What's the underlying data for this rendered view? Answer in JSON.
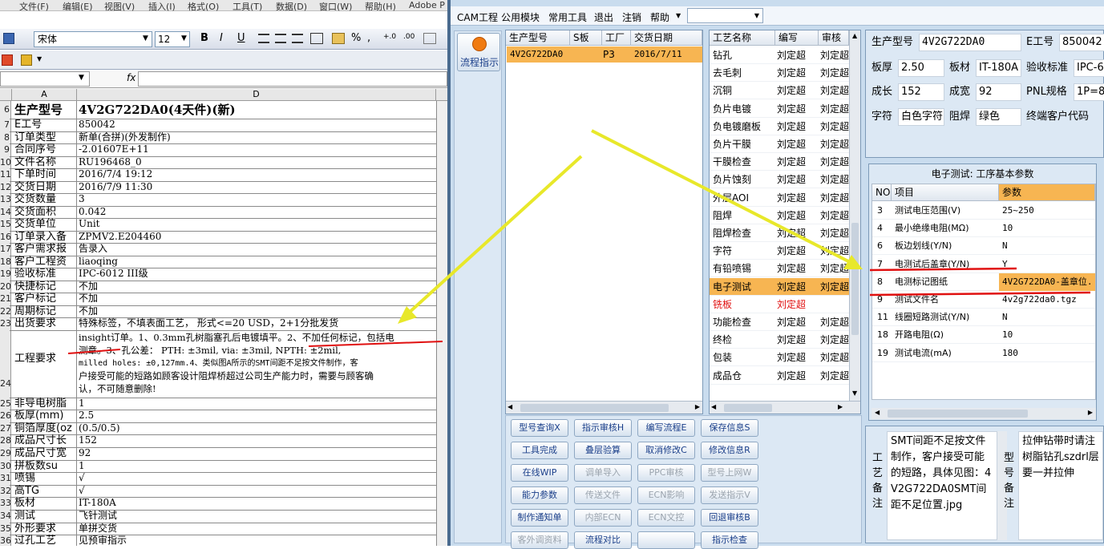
{
  "excel": {
    "menu": [
      "文件(F)",
      "编辑(E)",
      "视图(V)",
      "插入(I)",
      "格式(O)",
      "工具(T)",
      "数据(D)",
      "窗口(W)",
      "帮助(H)",
      "Adobe P"
    ],
    "font_name": "宋体",
    "font_size": "12",
    "format_buttons": [
      "B",
      "I",
      "U"
    ],
    "fx_label": "fx",
    "col_a": "A",
    "col_d": "D",
    "rows": [
      {
        "n": "6",
        "a": "生产型号",
        "d": "4V2G722DA0(4天件)(新)"
      },
      {
        "n": "7",
        "a": "E工号",
        "d": "850042"
      },
      {
        "n": "8",
        "a": "订单类型",
        "d": "新单(合拼)(外发制作)"
      },
      {
        "n": "9",
        "a": "合同序号",
        "d": "-2.01607E+11"
      },
      {
        "n": "10",
        "a": "文件名称",
        "d": "RU196468_0"
      },
      {
        "n": "11",
        "a": "下单时间",
        "d": "2016/7/4 19:12"
      },
      {
        "n": "12",
        "a": "交货日期",
        "d": "2016/7/9 11:30"
      },
      {
        "n": "13",
        "a": "交货数量",
        "d": "3"
      },
      {
        "n": "14",
        "a": "交货面积",
        "d": "0.042"
      },
      {
        "n": "15",
        "a": "交货单位",
        "d": "Unit"
      },
      {
        "n": "16",
        "a": "订单录入备",
        "d": "ZPMV2.E204460"
      },
      {
        "n": "17",
        "a": "客户需求报",
        "d": "告录入"
      },
      {
        "n": "18",
        "a": "客户工程资",
        "d": "liaoqing"
      },
      {
        "n": "19",
        "a": "验收标准",
        "d": "IPC-6012 III级"
      },
      {
        "n": "20",
        "a": "快捷标记",
        "d": "不加"
      },
      {
        "n": "21",
        "a": "客户标记",
        "d": "不加"
      },
      {
        "n": "22",
        "a": "周期标记",
        "d": "不加"
      },
      {
        "n": "23",
        "a": "出货要求",
        "d": "特殊标签，不填表面工艺， 形式<=20 USD，2+1分批发货"
      }
    ],
    "row24": {
      "n": "24",
      "a": "工程要求",
      "lines": [
        "insight订单。1、0.3mm孔树脂塞孔后电镀填平。2、不加任何标记，包括电",
        "测章。3、孔公差： PTH: ±3mil,  via: ±3mil,  NPTH: ±2mil,",
        "milled holes: ±0,127mm.4、类似图A所示的SMT间距不足按文件制作，客",
        "户接受可能的短路如顾客设计阻焊桥超过公司生产能力时，需要与顾客确",
        "认，不可随意删除!"
      ]
    },
    "rows2": [
      {
        "n": "25",
        "a": "非导电树脂",
        "d": "1"
      },
      {
        "n": "26",
        "a": "板厚(mm)",
        "d": "2.5"
      },
      {
        "n": "27",
        "a": "铜箔厚度(oz",
        "d": "(0.5/0.5)"
      },
      {
        "n": "28",
        "a": "成品尺寸长",
        "d": "152"
      },
      {
        "n": "29",
        "a": "成品尺寸宽",
        "d": "92"
      },
      {
        "n": "30",
        "a": "拼板数su",
        "d": "1"
      },
      {
        "n": "31",
        "a": "喷锡",
        "d": "√"
      },
      {
        "n": "32",
        "a": "高TG",
        "d": "√"
      },
      {
        "n": "33",
        "a": "板材",
        "d": "IT-180A"
      },
      {
        "n": "34",
        "a": "测试",
        "d": "飞针测试"
      },
      {
        "n": "35",
        "a": "外形要求",
        "d": "单拼交货"
      },
      {
        "n": "36",
        "a": "过孔工艺",
        "d": "见预审指示"
      }
    ]
  },
  "cam": {
    "menu": [
      "CAM工程",
      "公用模块",
      "常用工具",
      "退出",
      "注销",
      "帮助"
    ],
    "flow_button": "流程指示",
    "orders": {
      "headers": [
        "生产型号",
        "S板",
        "工厂",
        "交货日期"
      ],
      "row": {
        "model": "4V2G722DA0",
        "s": "",
        "factory": "P3",
        "date": "2016/7/11"
      }
    },
    "process": {
      "headers": [
        "工艺名称",
        "编写",
        "审核"
      ],
      "rows": [
        {
          "name": "钻孔",
          "w": "刘定超",
          "r": "刘定超"
        },
        {
          "name": "去毛刺",
          "w": "刘定超",
          "r": "刘定超"
        },
        {
          "name": "沉铜",
          "w": "刘定超",
          "r": "刘定超"
        },
        {
          "name": "负片电镀",
          "w": "刘定超",
          "r": "刘定超"
        },
        {
          "name": "负电镀磨板",
          "w": "刘定超",
          "r": "刘定超"
        },
        {
          "name": "负片干膜",
          "w": "刘定超",
          "r": "刘定超"
        },
        {
          "name": "干膜检查",
          "w": "刘定超",
          "r": "刘定超"
        },
        {
          "name": "负片蚀刻",
          "w": "刘定超",
          "r": "刘定超"
        },
        {
          "name": "外层AOI",
          "w": "刘定超",
          "r": "刘定超"
        },
        {
          "name": "阻焊",
          "w": "刘定超",
          "r": "刘定超"
        },
        {
          "name": "阻焊检查",
          "w": "刘定超",
          "r": "刘定超"
        },
        {
          "name": "字符",
          "w": "刘定超",
          "r": "刘定超"
        },
        {
          "name": "有铅喷锡",
          "w": "刘定超",
          "r": "刘定超"
        },
        {
          "name": "电子测试",
          "w": "刘定超",
          "r": "刘定超"
        },
        {
          "name": "铣板",
          "w": "刘定超",
          "r": ""
        },
        {
          "name": "功能检查",
          "w": "刘定超",
          "r": "刘定超"
        },
        {
          "name": "终检",
          "w": "刘定超",
          "r": "刘定超"
        },
        {
          "name": "包装",
          "w": "刘定超",
          "r": "刘定超"
        },
        {
          "name": "成品仓",
          "w": "刘定超",
          "r": "刘定超"
        }
      ]
    },
    "info": {
      "model_label": "生产型号",
      "model": "4V2G722DA0",
      "eno_label": "E工号",
      "eno": "850042",
      "thick_label": "板厚",
      "thick": "2.50",
      "mat_label": "板材",
      "mat": "IT-180A",
      "std_label": "验收标准",
      "std": "IPC-6",
      "len_label": "成长",
      "len": "152",
      "wid_label": "成宽",
      "wid": "92",
      "pnl_label": "PNL规格",
      "pnl": "1P=8",
      "char_label": "字符",
      "char": "白色字符",
      "mask_label": "阻焊",
      "mask": "绿色",
      "cust_label": "终端客户代码"
    },
    "params": {
      "title": "电子测试: 工序基本参数",
      "headers": [
        "NO",
        "项目",
        "参数"
      ],
      "rows": [
        {
          "no": "3",
          "item": "测试电压范围(V)",
          "val": "25~250"
        },
        {
          "no": "4",
          "item": "最小绝缘电阻(MΩ)",
          "val": "10"
        },
        {
          "no": "6",
          "item": "板边划线(Y/N)",
          "val": "N"
        },
        {
          "no": "7",
          "item": "电测试后盖章(Y/N)",
          "val": "Y"
        },
        {
          "no": "8",
          "item": "电测标记图纸",
          "val": "4V2G722DA0-盖章位."
        },
        {
          "no": "9",
          "item": "测试文件名",
          "val": "4v2g722da0.tgz"
        },
        {
          "no": "11",
          "item": "线圈短路测试(Y/N)",
          "val": "N"
        },
        {
          "no": "18",
          "item": "开路电阻(Ω)",
          "val": "10"
        },
        {
          "no": "19",
          "item": "测试电流(mA)",
          "val": "180"
        }
      ]
    },
    "buttons": [
      [
        "型号查询X",
        "指示审核H",
        "编写流程E",
        "保存信息S"
      ],
      [
        "工具完成",
        "叠层验算",
        "取消修改C",
        "修改信息R"
      ],
      [
        "在线WIP",
        "调单导入",
        "PPC审核",
        "型号上网W"
      ],
      [
        "能力参数",
        "传送文件",
        "ECN影响",
        "发送指示V"
      ],
      [
        "制作通知单",
        "内部ECN",
        "ECN文控",
        "回退审核B"
      ],
      [
        "客外调资料",
        "流程对比",
        "",
        "指示检查"
      ]
    ],
    "notes": {
      "craft_label": "工艺备注",
      "craft_text": "SMT间距不足按文件制作，客户接受可能的短路，具体见图：4V2G722DA0SMT间距不足位置.jpg",
      "model_label": "型号备注",
      "model_text": "拉伸钻带时请注树脂钻孔szdrl层要一并拉伸"
    }
  }
}
